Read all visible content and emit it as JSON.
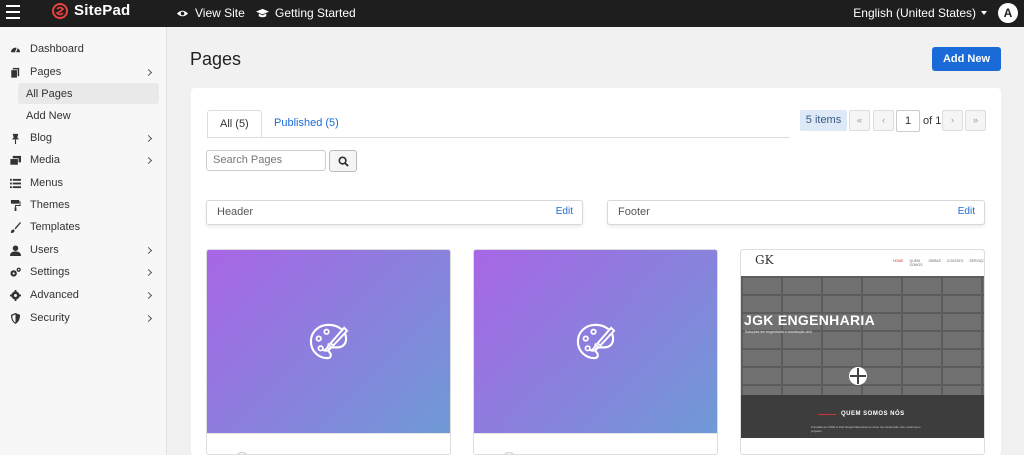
{
  "topbar": {
    "brand": "SitePad",
    "view_site": "View Site",
    "getting_started": "Getting Started",
    "language": "English (United States)",
    "avatar_letter": "A"
  },
  "sidebar": {
    "items": [
      {
        "label": "Dashboard",
        "icon": "dashboard-icon"
      },
      {
        "label": "Pages",
        "icon": "pages-icon"
      },
      {
        "label": "Blog",
        "icon": "pin-icon"
      },
      {
        "label": "Media",
        "icon": "media-icon"
      },
      {
        "label": "Menus",
        "icon": "list-icon"
      },
      {
        "label": "Themes",
        "icon": "paint-roller-icon"
      },
      {
        "label": "Templates",
        "icon": "brush-icon"
      },
      {
        "label": "Users",
        "icon": "user-icon"
      },
      {
        "label": "Settings",
        "icon": "cogs-icon"
      },
      {
        "label": "Advanced",
        "icon": "gear-icon"
      },
      {
        "label": "Security",
        "icon": "shield-icon"
      }
    ],
    "sub_items": [
      {
        "label": "All Pages",
        "active": true
      },
      {
        "label": "Add New",
        "active": false
      }
    ]
  },
  "main": {
    "title": "Pages",
    "add_new": "Add New",
    "tabs": [
      {
        "label": "All (5)",
        "active": true
      },
      {
        "label": "Published (5)",
        "active": false
      }
    ],
    "pagination": {
      "items_count": "5 items",
      "first": "«",
      "prev": "‹",
      "current_page": "1",
      "of_total": "of 1",
      "next": "›",
      "last": "»"
    },
    "search": {
      "placeholder": "Search Pages"
    },
    "blocks": [
      {
        "title": "Header",
        "edit": "Edit"
      },
      {
        "title": "Footer",
        "edit": "Edit"
      }
    ],
    "cards": [
      {
        "type": "placeholder",
        "icon": "palette-icon"
      },
      {
        "type": "placeholder",
        "icon": "palette-icon"
      },
      {
        "type": "preview",
        "logo": "GK",
        "nav": [
          "HOME",
          "QUEM SOMOS",
          "OBRAS",
          "CONTATO",
          "SERVIÇOS"
        ],
        "headline": "JGK ENGENHARIA",
        "subheadline": "Soluções em engenharia e construção civil",
        "section_title": "QUEM SOMOS NÓS",
        "section_text": "Fundada em 2020 a JGK Engenharia atua no ramo de construção civil, reformas e projetos."
      }
    ]
  },
  "colors": {
    "accent": "#1a6bd8",
    "topbar": "#1e1e1e",
    "gradient_start": "#a866e6",
    "gradient_end": "#6f9ad6"
  }
}
